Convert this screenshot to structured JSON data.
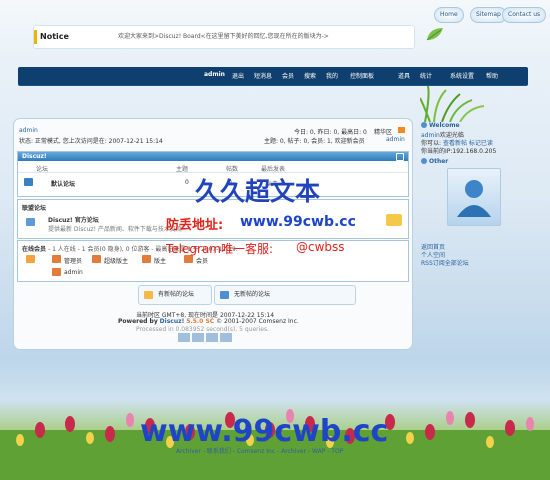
{
  "top_links": {
    "home": "Home",
    "sitemap": "Sitemap",
    "contact": "Contact us"
  },
  "notice": {
    "label": "Notice",
    "text": "欢迎大家来到>Discuz! Board<在这里留下美好的回忆,您现在所在的版块为->"
  },
  "menu": {
    "items": [
      "admin",
      "退出",
      "短消息",
      "会员",
      "搜索",
      "我的",
      "控制面板",
      "道具",
      "统计",
      "系统设置",
      "帮助"
    ]
  },
  "user_bar": {
    "user": "admin",
    "state": "状态: 正常模式, 您上次访问是在: 2007-12-21 15:14",
    "today": "今日: 0, 昨日: 0, 最高日: 0",
    "digest": "精华区",
    "stats": "主题: 0, 帖子: 0, 会员: 1, 欢迎新会员",
    "newest": "admin"
  },
  "forum_table": {
    "category": "Discuz!",
    "columns": [
      "论坛",
      "主题",
      "帖数",
      "最后发表"
    ],
    "rows": [
      {
        "name": "默认论坛",
        "threads": "0",
        "posts": "0",
        "last": "从未"
      }
    ]
  },
  "links_section": {
    "title": "联盟论坛",
    "site": "Discuz! 官方论坛",
    "desc": "提供最新 Discuz! 产品新闻、软件下载与技术交流"
  },
  "online": {
    "title": "在线会员",
    "summary": "- 1 人在线 - 1 会员(0 隐身), 0 位游客 - 最高记录是 1 于 2007-12-19.",
    "legend": [
      "管理员",
      "超级版主",
      "版主",
      "会员"
    ],
    "users": [
      "admin"
    ]
  },
  "status_buttons": {
    "new": "有新帖的论坛",
    "none": "无新帖的论坛"
  },
  "footer": {
    "time": "当前时区 GMT+8, 现在时间是 2007-12-22 15:14",
    "powered_label": "Powered by",
    "powered_name": "Discuz!",
    "version": "5.5.0 SC",
    "copyright": "© 2001-2007 Comsenz Inc.",
    "processed": "Processed in 0.083952 second(s), 5 queries."
  },
  "sidebar": {
    "welcome": {
      "title": "Welcome",
      "lines": [
        {
          "a": "admin",
          "b": "欢迎光临"
        },
        {
          "a": "你可以:",
          "b": "查看新帖 标记已读"
        },
        {
          "a": "你当前的IP:",
          "b": "192.168.0.205"
        }
      ]
    },
    "other": {
      "title": "Other",
      "links": [
        "返回首页",
        "个人空间",
        "RSS订阅全部论坛"
      ]
    }
  },
  "watermarks": {
    "title": "久久超文本",
    "url_label": "防丢地址:",
    "url": "www.99cwb.cc",
    "telegram": "Telegram唯一客服:",
    "handle": "@cwbss",
    "bottom": "www.99cwb.cc",
    "bottom_nav": "Archiver - 联系我们 - Comsenz Inc - Archiver - WAP - TOP"
  },
  "colors": {
    "accent": "#2e7cbd",
    "menubar": "#0f3f6e",
    "watermark": "#1e45c8",
    "watermark_red": "#e0241c",
    "notice_bar": "#f0b400"
  }
}
